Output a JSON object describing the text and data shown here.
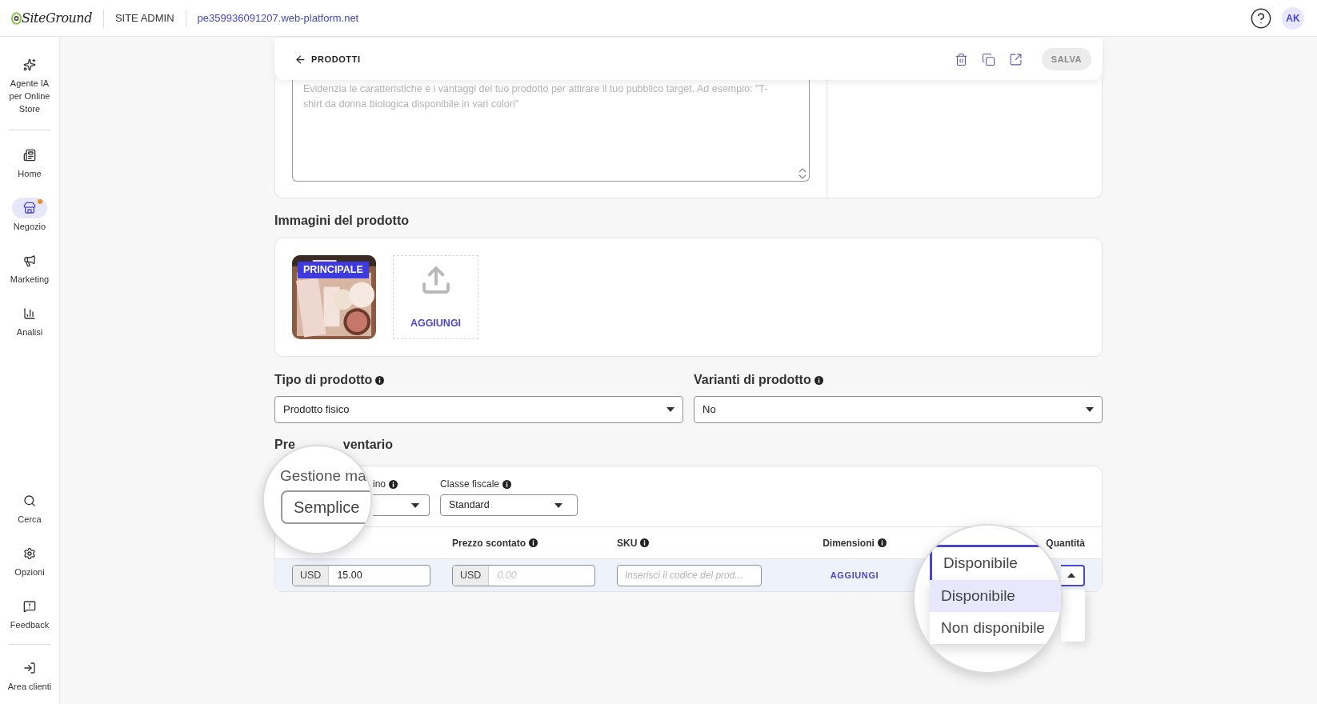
{
  "topbar": {
    "logo": "SiteGround",
    "section": "SITE ADMIN",
    "domain": "pe359936091207.web-platform.net",
    "avatar": "AK"
  },
  "sidebar": {
    "top": [
      {
        "label": "Agente IA per Online Store",
        "selected": false,
        "notification": false
      }
    ],
    "main": [
      {
        "label": "Home",
        "selected": false,
        "notification": false
      },
      {
        "label": "Negozio",
        "selected": true,
        "notification": true
      },
      {
        "label": "Marketing",
        "selected": false,
        "notification": false
      },
      {
        "label": "Analisi",
        "selected": false,
        "notification": false
      }
    ],
    "bottom": [
      {
        "label": "Cerca",
        "selected": false,
        "notification": false
      },
      {
        "label": "Opzioni",
        "selected": false,
        "notification": false
      },
      {
        "label": "Feedback",
        "selected": false,
        "notification": false
      }
    ],
    "footer": [
      {
        "label": "Area clienti",
        "selected": false,
        "notification": false
      }
    ]
  },
  "header": {
    "back": "PRODOTTI",
    "save": {
      "label": "SALVA",
      "disabled": true
    }
  },
  "description": {
    "placeholder": "Evidenzia le caratteristiche e i vantaggi del tuo prodotto per attirare il tuo pubblico target. Ad esempio: \"T-shirt da donna biologica disponibile in vari colori\""
  },
  "images": {
    "title": "Immagini del prodotto",
    "items": [
      {
        "kind": "picture",
        "badge": "PRINCIPALE"
      }
    ],
    "add": "AGGIUNGI"
  },
  "product_type": {
    "label": "Tipo di prodotto",
    "value": "Prodotto fisico"
  },
  "variants": {
    "label": "Varianti di prodotto",
    "value": "No"
  },
  "pricing": {
    "title_parts": [
      "Pre",
      "ventario"
    ],
    "stock_label_part": "ino",
    "tax_label": "Classe fiscale",
    "tax_value": "Standard",
    "columns": [
      {
        "label": "Prezzo scontato",
        "info": true
      },
      {
        "label": "SKU",
        "info": true
      },
      {
        "label": "Dimensioni",
        "info": true
      },
      {
        "label": "Quantità",
        "info": false
      }
    ],
    "row": {
      "price_currency": "USD",
      "price": "15.00",
      "discount_currency": "USD",
      "discount_placeholder": "0.00",
      "sku_placeholder": "Inserisci il codice del prod...",
      "dimensions_action": "AGGIUNGI",
      "quantity_open": true
    },
    "stock_zoom": {
      "label": "Gestione ma",
      "value": "Semplice"
    },
    "quantity_zoom": {
      "value": "Disponibile",
      "options": [
        {
          "label": "Disponibile",
          "selected": true
        },
        {
          "label": "Non disponibile",
          "selected": false
        }
      ]
    }
  }
}
